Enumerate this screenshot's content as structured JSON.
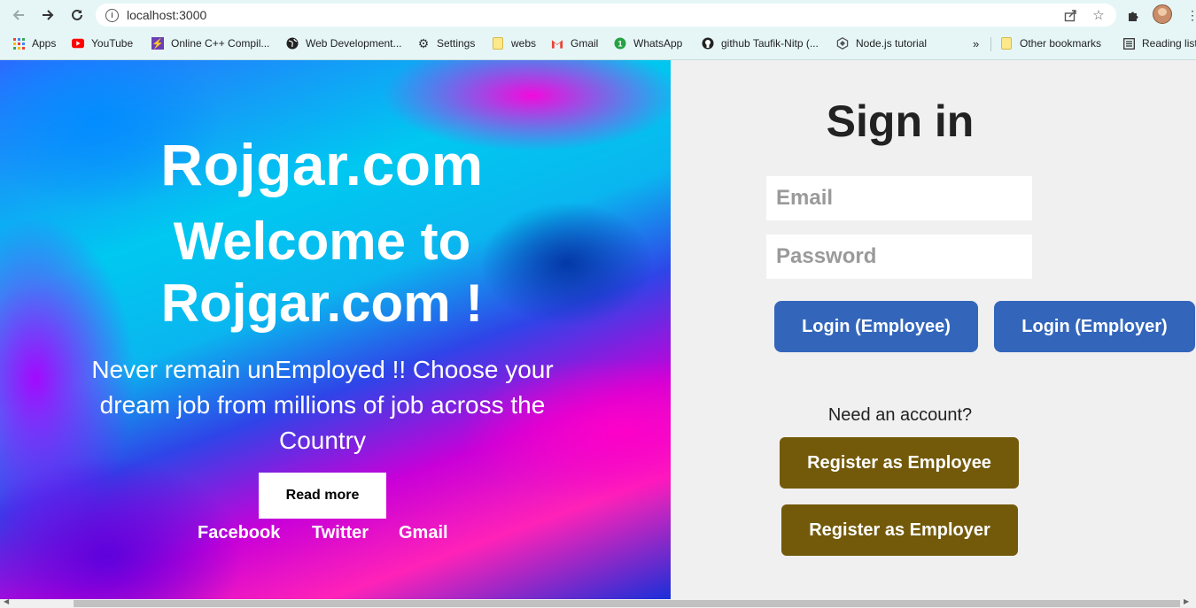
{
  "browser": {
    "url": "localhost:3000",
    "bookmarks": [
      {
        "label": "Apps",
        "icon": "apps-grid-icon"
      },
      {
        "label": "YouTube",
        "icon": "youtube-icon"
      },
      {
        "label": "Online C++ Compil...",
        "icon": "lightning-icon"
      },
      {
        "label": "Web Development...",
        "icon": "globe-icon"
      },
      {
        "label": "Settings",
        "icon": "gear-icon"
      },
      {
        "label": "webs",
        "icon": "folder-icon"
      },
      {
        "label": "Gmail",
        "icon": "gmail-icon"
      },
      {
        "label": "WhatsApp",
        "icon": "whatsapp-icon"
      },
      {
        "label": "github Taufik-Nitp (...",
        "icon": "github-icon"
      },
      {
        "label": "Node.js tutorial",
        "icon": "nodejs-icon"
      }
    ],
    "more_bookmarks": "»",
    "other_bookmarks": "Other bookmarks",
    "reading_list": "Reading list"
  },
  "hero": {
    "brand": "Rojgar.com",
    "welcome": "Welcome to Rojgar.com !",
    "tagline": "Never remain unEmployed !! Choose your dream job from millions of job across the Country",
    "read_more": "Read more",
    "social": [
      "Facebook",
      "Twitter",
      "Gmail"
    ]
  },
  "signin": {
    "title": "Sign in",
    "email_placeholder": "Email",
    "password_placeholder": "Password",
    "login_employee": "Login (Employee)",
    "login_employer": "Login (Employer)",
    "need_account": "Need an account?",
    "register_employee": "Register as Employee",
    "register_employer": "Register as Employer"
  },
  "colors": {
    "login_button": "#3366bb",
    "register_button": "#735a0a",
    "panel_background": "#f0f0f0"
  }
}
